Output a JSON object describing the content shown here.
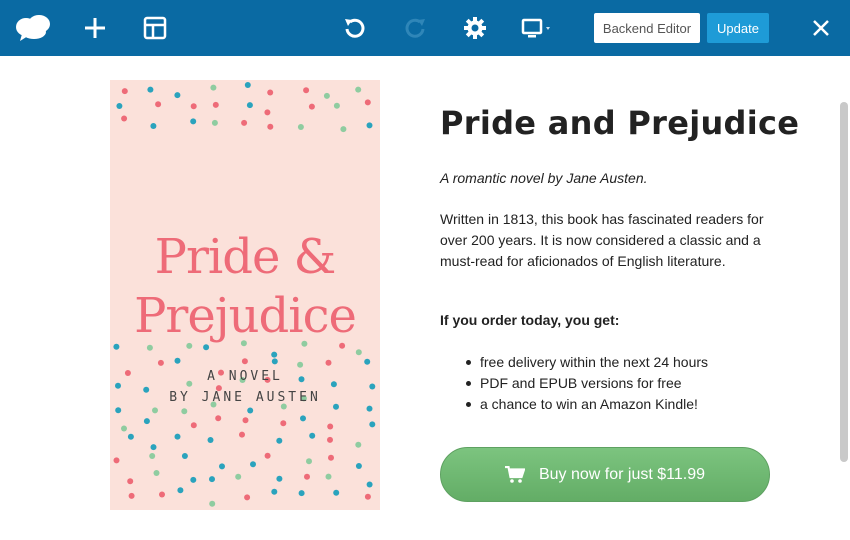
{
  "toolbar": {
    "backend_label": "Backend Editor",
    "update_label": "Update",
    "colors": {
      "bar": "#0a6aa3",
      "update": "#1e9bd7"
    },
    "icons": [
      "logo-cloud-icon",
      "plus-icon",
      "layout-icon",
      "undo-icon",
      "redo-icon",
      "gear-icon",
      "monitor-icon",
      "close-icon"
    ]
  },
  "cover": {
    "title_line1": "Pride &",
    "title_line2": "Prejudice",
    "subtitle_line1": "A NOVEL",
    "subtitle_line2": "BY JANE AUSTEN",
    "colors": {
      "background": "#fbe1da",
      "title": "#ee6b78",
      "dots": [
        "#ee6b78",
        "#2aa3bd",
        "#8fcca0"
      ]
    }
  },
  "content": {
    "title": "Pride and Prejudice",
    "tagline": "A romantic novel by Jane Austen.",
    "description": "Written in 1813, this book has fascinated readers for over 200 years. It is now considered a classic and a must-read for aficionados of English literature.",
    "offer_heading": "If you order today, you get:",
    "benefits": [
      "free delivery within the next 24 hours",
      "PDF and EPUB versions for free",
      "a chance to win an Amazon Kindle!"
    ],
    "buy_label": "Buy now for just $11.99",
    "buy_color": "#6ab56d"
  }
}
